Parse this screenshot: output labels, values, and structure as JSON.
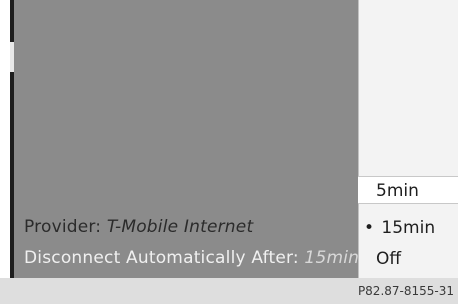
{
  "screen": {
    "provider_label": "Provider:",
    "provider_value": "T-Mobile Internet",
    "disconnect_label": "Disconnect Automatically After:",
    "disconnect_value": "15min"
  },
  "menu": {
    "items": [
      {
        "label": "5min",
        "selected": false,
        "bullet": ""
      },
      {
        "label": "15min",
        "selected": true,
        "bullet": "•"
      },
      {
        "label": "Off",
        "selected": false,
        "bullet": ""
      }
    ],
    "highlighted_index": 0
  },
  "footer": {
    "reference_code": "P82.87-8155-31"
  },
  "colors": {
    "screen_bg": "#8b8b8b",
    "panel_bg": "#f3f3f3",
    "highlight_bg": "#ffffff"
  }
}
